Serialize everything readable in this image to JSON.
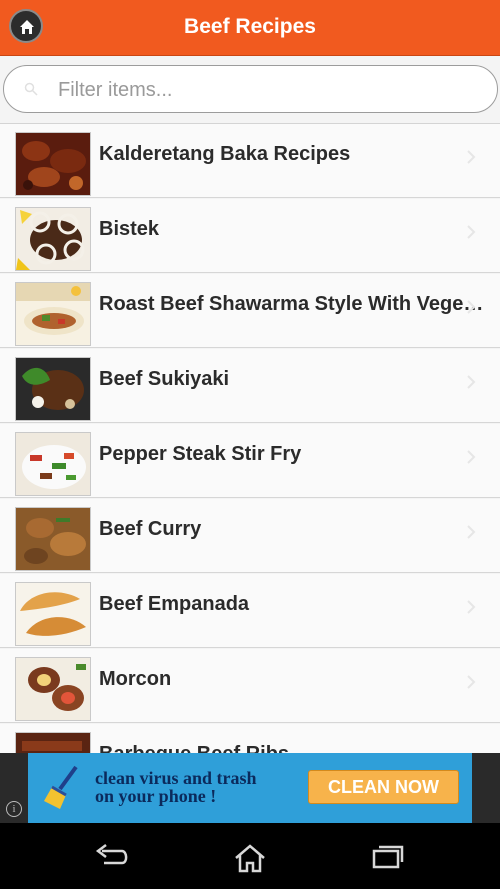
{
  "header": {
    "title": "Beef Recipes",
    "home_icon": "home-icon"
  },
  "search": {
    "placeholder": "Filter items..."
  },
  "recipes": [
    {
      "label": "Kalderetang Baka Recipes"
    },
    {
      "label": "Bistek"
    },
    {
      "label": "Roast Beef Shawarma Style With Vegetables"
    },
    {
      "label": "Beef Sukiyaki"
    },
    {
      "label": "Pepper Steak Stir Fry"
    },
    {
      "label": "Beef Curry"
    },
    {
      "label": "Beef Empanada"
    },
    {
      "label": "Morcon"
    },
    {
      "label": "Barbeque Beef Ribs"
    }
  ],
  "ad": {
    "line1": "clean virus and trash",
    "line2": "on your phone !",
    "button_label": "CLEAN NOW",
    "info_glyph": "i"
  },
  "colors": {
    "header": "#f15a1f",
    "ad_banner": "#2f9fd9",
    "ad_button": "#f7b34b"
  }
}
